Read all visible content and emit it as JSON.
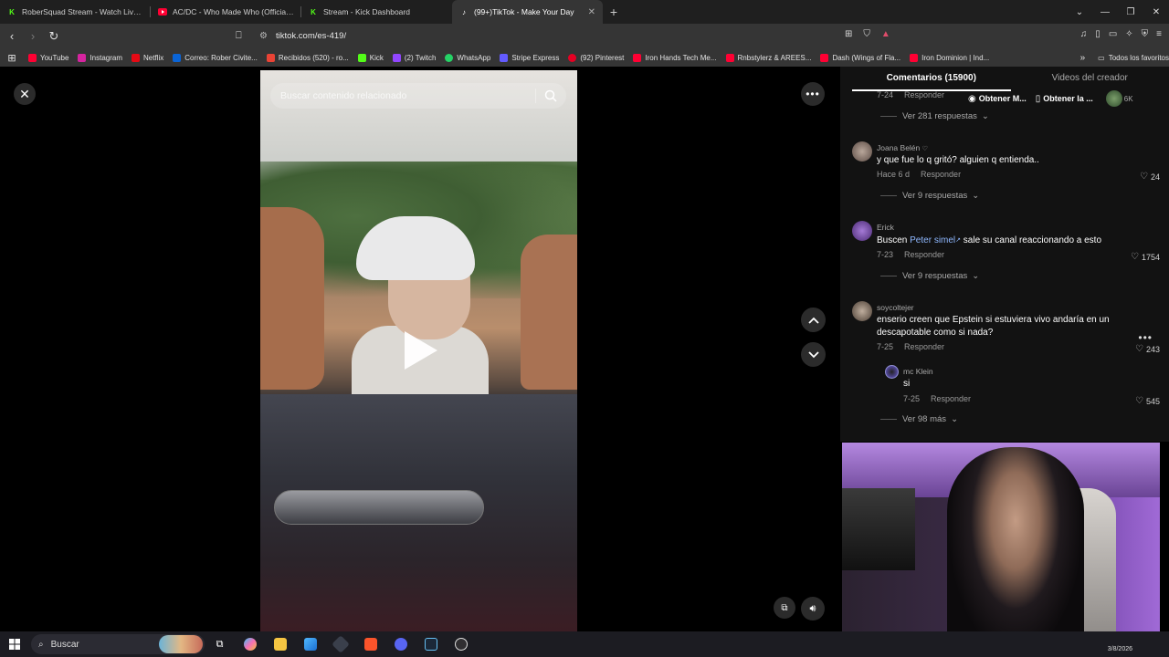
{
  "tabs": [
    {
      "title": "RoberSquad Stream - Watch Live on",
      "icon": "kick-icon",
      "color": "#53fc18",
      "active": false
    },
    {
      "title": "AC/DC - Who Made Who (Official HD",
      "icon": "youtube-icon",
      "color": "#ff0033",
      "active": false
    },
    {
      "title": "Stream - Kick Dashboard",
      "icon": "kick-icon",
      "color": "#53fc18",
      "active": false
    },
    {
      "title": "(99+)TikTok - Make Your Day",
      "icon": "tiktok-icon",
      "color": "#ffffff",
      "active": true
    }
  ],
  "address": {
    "url": "tiktok.com/es-419/"
  },
  "bookmarks": [
    {
      "label": "YouTube",
      "color": "#ff0033"
    },
    {
      "label": "Instagram",
      "color": "#d6249f"
    },
    {
      "label": "Netflix",
      "color": "#e50914"
    },
    {
      "label": "Correo: Rober Civite...",
      "color": "#0a64d6"
    },
    {
      "label": "Recibidos (520) - ro...",
      "color": "#ea4335"
    },
    {
      "label": "Kick",
      "color": "#53fc18"
    },
    {
      "label": "(2) Twitch",
      "color": "#9146ff"
    },
    {
      "label": "WhatsApp",
      "color": "#25d366"
    },
    {
      "label": "Stripe Express",
      "color": "#635bff"
    },
    {
      "label": "(92) Pinterest",
      "color": "#e60023"
    },
    {
      "label": "Iron Hands Tech Me...",
      "color": "#ff0033"
    },
    {
      "label": "Rnbstylerz & AREES...",
      "color": "#ff0033"
    },
    {
      "label": "Dash (Wings of Fla...",
      "color": "#ff0033"
    },
    {
      "label": "Iron Dominion | Ind...",
      "color": "#ff0033"
    }
  ],
  "bookmarks_all": "Todos los favoritos",
  "video": {
    "search_placeholder": "Buscar contenido relacionado"
  },
  "panel": {
    "tab_comments": "Comentarios (15900)",
    "tab_creator": "Videos del creador",
    "overlay": {
      "get_m": "Obtener M...",
      "get_la": "Obtener la ...",
      "count": "6K"
    },
    "top_meta": {
      "date": "7-24",
      "reply": "Responder"
    },
    "top_view": "Ver 281 respuestas",
    "comments": [
      {
        "user": "Joana Belén",
        "text": "y que fue lo q gritó? alguien q entienda..",
        "date": "Hace 6 d",
        "reply": "Responder",
        "likes": "24",
        "more": "Ver 9 respuestas",
        "mention": "",
        "text_after": ""
      },
      {
        "user": "Erick",
        "text": "Buscen ",
        "mention": "Peter simel",
        "text_after": " sale su canal reaccionando a esto",
        "date": "7-23",
        "reply": "Responder",
        "likes": "1754",
        "more": "Ver 9 respuestas"
      },
      {
        "user": "soycoltejer",
        "text": "enserio creen que Epstein si estuviera vivo andaría en un descapotable como si nada?",
        "date": "7-25",
        "reply": "Responder",
        "likes": "243",
        "more": "",
        "mention": "",
        "text_after": ""
      }
    ],
    "reply": {
      "user": "mc Klein",
      "text": "si",
      "date": "7-25",
      "reply": "Responder",
      "likes": "545"
    },
    "view_more": "Ver 98 más"
  },
  "taskbar": {
    "search": "Buscar",
    "date": "3/8/2026"
  }
}
